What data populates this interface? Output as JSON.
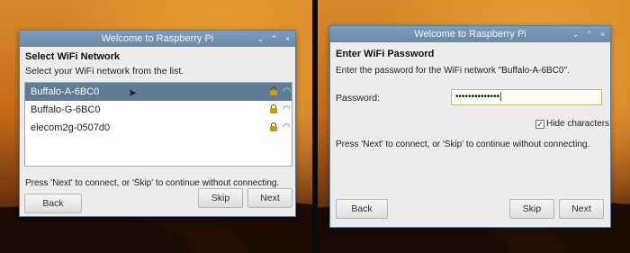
{
  "left_window": {
    "title": "Welcome to Raspberry Pi",
    "controls": [
      "⌄",
      "⌃",
      "×"
    ],
    "heading": "Select WiFi Network",
    "instruction": "Select your WiFi network from the list.",
    "networks": [
      {
        "ssid": "Buffalo-A-6BC0",
        "secured": true,
        "selected": true
      },
      {
        "ssid": "Buffalo-G-6BC0",
        "secured": true,
        "selected": false
      },
      {
        "ssid": "elecom2g-0507d0",
        "secured": true,
        "selected": false
      }
    ],
    "footer": "Press 'Next' to connect, or 'Skip' to continue without connecting.",
    "back_label": "Back",
    "skip_label": "Skip",
    "next_label": "Next"
  },
  "right_window": {
    "title": "Welcome to Raspberry Pi",
    "controls": [
      "⌄",
      "⌃",
      "×"
    ],
    "heading": "Enter WiFi Password",
    "instruction": "Enter the password for the WiFi network \"Buffalo-A-6BC0\".",
    "password_label": "Password:",
    "password_value": "••••••••••••••|",
    "hide_characters_label": "Hide characters",
    "hide_characters_checked": "✓",
    "footer": "Press 'Next' to connect, or 'Skip' to continue without connecting.",
    "back_label": "Back",
    "skip_label": "Skip",
    "next_label": "Next"
  },
  "colors": {
    "titlebar": "#6a88a8",
    "selection": "#5f7c99",
    "window_bg": "#ececec"
  }
}
